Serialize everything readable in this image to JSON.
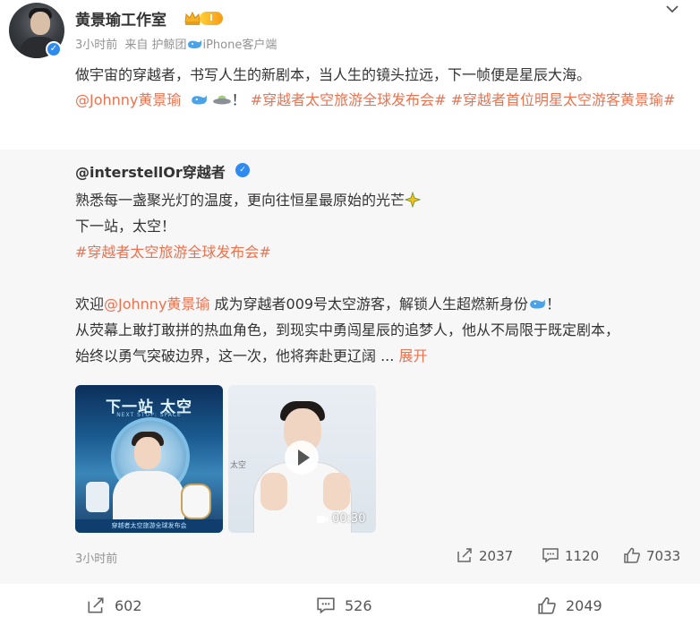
{
  "post": {
    "author": "黄景瑜工作室",
    "level": "I",
    "time": "3小时前",
    "source_prefix": "来自",
    "source_client": "护鲸团",
    "source_device": "iPhone客户端",
    "text_line1": "做宇宙的穿越者，书写人生的新剧本，当人生的镜头拉远，下一帧便是星辰大海。",
    "mention": "@Johnny黄景瑜",
    "after_mention": "！",
    "hashtag1": "#穿越者太空旅游全球发布会#",
    "hashtag2": "#穿越者首位明星太空游客黄景瑜#"
  },
  "retweet": {
    "author": "@interstellOr穿越者",
    "line1": "熟悉每一盏聚光灯的温度，更向往恒星最原始的光芒",
    "line2": "下一站，太空！",
    "hashtag": "#穿越者太空旅游全球发布会#",
    "line4_prefix": "欢迎",
    "line4_mention": "@Johnny黄景瑜",
    "line4_suffix": " 成为穿越者009号太空游客，解锁人生超燃新身份",
    "line4_end": "！",
    "line5": "从荧幕上敢打敢拼的热血角色，到现实中勇闯星辰的追梦人，他从不局限于既定剧本，",
    "line6": "始终以勇气突破边界，这一次，他将奔赴更辽阔 ...",
    "expand_label": "展开",
    "image1_title": "下一站 太空",
    "image1_subtitle": "NEXT STOP: SPACE",
    "image1_footer": "穿越者太空旅游全球发布会",
    "image2_side_text": "太空",
    "video_duration": "00:30",
    "time": "3小时前",
    "reposts": "2037",
    "comments": "1120",
    "likes": "7033"
  },
  "footer": {
    "reposts": "602",
    "comments": "526",
    "likes": "2049"
  },
  "colors": {
    "link": "#eb7350",
    "verified": "#2f8bf0",
    "meta": "#939393",
    "retweet_bg": "#f7f7f7"
  },
  "icons": [
    "verified-icon",
    "crown-icon",
    "whale-icon",
    "ufo-icon",
    "sparkle-icon",
    "chevron-down-icon",
    "repost-icon",
    "comment-icon",
    "like-icon",
    "play-icon"
  ]
}
